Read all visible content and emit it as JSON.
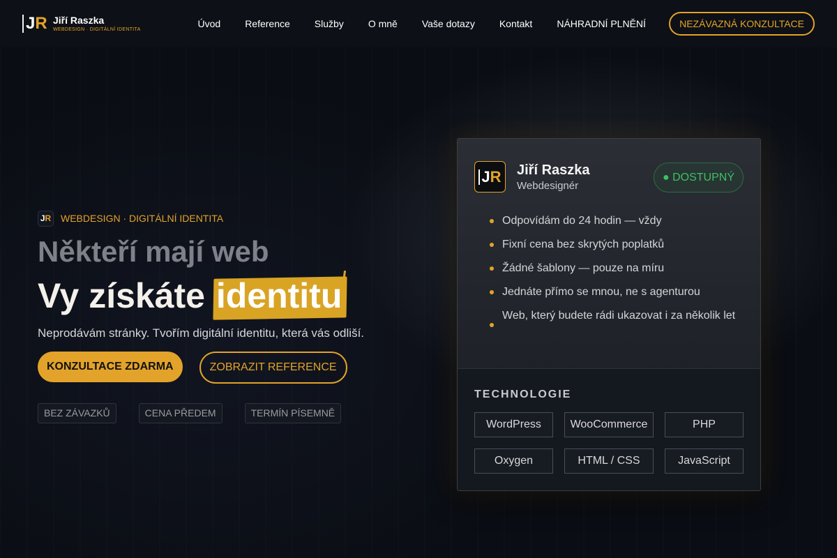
{
  "header": {
    "logo": {
      "mark_j": "J",
      "mark_r": "R",
      "name": "Jiří Raszka",
      "subtitle": "WEBDESIGN · DIGITÁLNÍ IDENTITA"
    },
    "nav": [
      {
        "label": "Úvod"
      },
      {
        "label": "Reference"
      },
      {
        "label": "Služby"
      },
      {
        "label": "O mně"
      },
      {
        "label": "Vaše dotazy"
      },
      {
        "label": "Kontakt"
      },
      {
        "label": "NÁHRADNÍ PLNĚNÍ"
      }
    ],
    "cta_label": "NEZÁVAZNÁ KONZULTACE"
  },
  "hero": {
    "eyebrow": "WEBDESIGN · DIGITÁLNÍ IDENTITA",
    "headline_1": "Někteří mají web",
    "headline_2_prefix": "Vy získáte ",
    "headline_2_highlight": "identitu",
    "lead": "Neprodávám stránky. Tvořím digitální identitu, která vás odliší.",
    "primary_button": "KONZULTACE ZDARMA",
    "secondary_button": "ZOBRAZIT REFERENCE",
    "badges": [
      "BEZ ZÁVAZKŮ",
      "CENA PŘEDEM",
      "TERMÍN PÍSEMNĚ"
    ]
  },
  "card": {
    "name": "Jiří Raszka",
    "role": "Webdesignér",
    "status": "● DOSTUPNÝ",
    "features": [
      "Odpovídám do 24 hodin — vždy",
      "Fixní cena bez skrytých poplatků",
      "Žádné šablony — pouze na míru",
      "Jednáte přímo se mnou, ne s agenturou",
      "Web, který budete rádi ukazovat i za několik let"
    ],
    "tech_title": "TECHNOLOGIE",
    "tech": [
      "WordPress",
      "WooCommerce",
      "PHP",
      "Oxygen",
      "HTML / CSS",
      "JavaScript"
    ]
  },
  "colors": {
    "accent": "#e3a32a",
    "background": "#0a0d13",
    "status_green": "#3fbf66"
  }
}
